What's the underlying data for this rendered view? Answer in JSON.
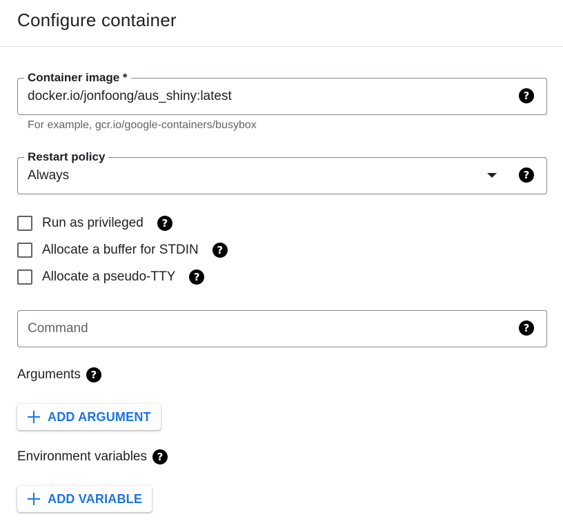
{
  "header": {
    "title": "Configure container"
  },
  "container_image": {
    "label": "Container image *",
    "value": "docker.io/jonfoong/aus_shiny:latest",
    "hint": "For example, gcr.io/google-containers/busybox",
    "help_icon": "help-icon"
  },
  "restart_policy": {
    "label": "Restart policy",
    "selected": "Always",
    "help_icon": "help-icon"
  },
  "options": [
    {
      "label": "Run as privileged",
      "checked": false
    },
    {
      "label": "Allocate a buffer for STDIN",
      "checked": false
    },
    {
      "label": "Allocate a pseudo-TTY",
      "checked": false
    }
  ],
  "command": {
    "placeholder": "Command",
    "value": ""
  },
  "arguments": {
    "label": "Arguments",
    "button_label": "ADD ARGUMENT"
  },
  "environment": {
    "label": "Environment variables",
    "button_label": "ADD VARIABLE"
  },
  "colors": {
    "accent": "#1a73e8",
    "text": "#202124",
    "muted": "#5f6368",
    "border": "#80868b"
  }
}
